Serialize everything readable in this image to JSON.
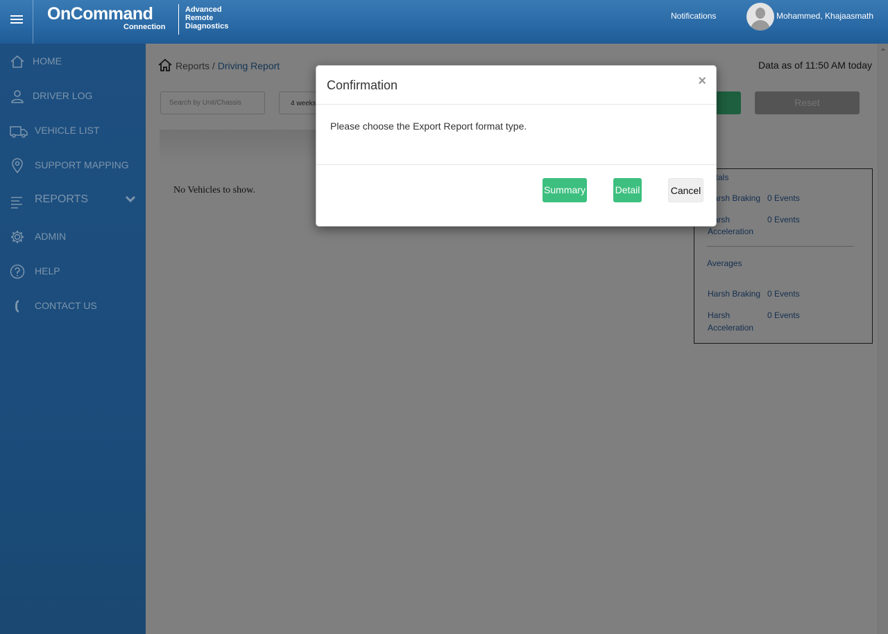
{
  "header": {
    "logo_main": "OnCommand",
    "logo_sub": "Connection",
    "logo_product_line1": "Advanced",
    "logo_product_line2": "Remote",
    "logo_product_line3": "Diagnostics",
    "notifications_label": "Notifications",
    "user_name": "Mohammed, Khajaasmath"
  },
  "sidebar": {
    "items": [
      {
        "label": "HOME",
        "icon": "home-icon"
      },
      {
        "label": "DRIVER LOG",
        "icon": "person-icon"
      },
      {
        "label": "VEHICLE LIST",
        "icon": "truck-icon"
      },
      {
        "label": "SUPPORT MAPPING",
        "icon": "map-pin-icon"
      },
      {
        "label": "REPORTS",
        "icon": "list-icon"
      },
      {
        "label": "ADMIN",
        "icon": "gear-icon"
      },
      {
        "label": "HELP",
        "icon": "question-icon"
      },
      {
        "label": "CONTACT US",
        "icon": "phone-icon"
      }
    ]
  },
  "breadcrumb": {
    "root": "Reports",
    "separator": " / ",
    "current": "Driving Report"
  },
  "data_as_of": "Data as of 11:50 AM today",
  "filters": {
    "search_placeholder": "Search by Unit/Chassis",
    "period_value": "4 weeks",
    "reset_label": "Reset"
  },
  "grid": {
    "empty_message": "No Vehicles to show."
  },
  "totals_panel": {
    "totals_heading": "Totals",
    "totals_rows": [
      {
        "label": "Harsh Braking",
        "value": "0 Events"
      },
      {
        "label_line1": "Harsh",
        "label_line2": "Acceleration",
        "value": "0 Events"
      }
    ],
    "averages_heading": "Averages",
    "averages_rows": [
      {
        "label": "Harsh Braking",
        "value": "0 Events"
      },
      {
        "label_line1": "Harsh",
        "label_line2": "Acceleration",
        "value": "0 Events"
      }
    ]
  },
  "modal": {
    "title": "Confirmation",
    "close_symbol": "×",
    "message": "Please choose the Export Report format type.",
    "summary_label": "Summary",
    "detail_label": "Detail",
    "cancel_label": "Cancel"
  },
  "colors": {
    "header_blue": "#2a6aa6",
    "sidebar_blue": "#1d4f80",
    "accent_green": "#3dbf7f",
    "link_blue": "#2a6aa6"
  }
}
